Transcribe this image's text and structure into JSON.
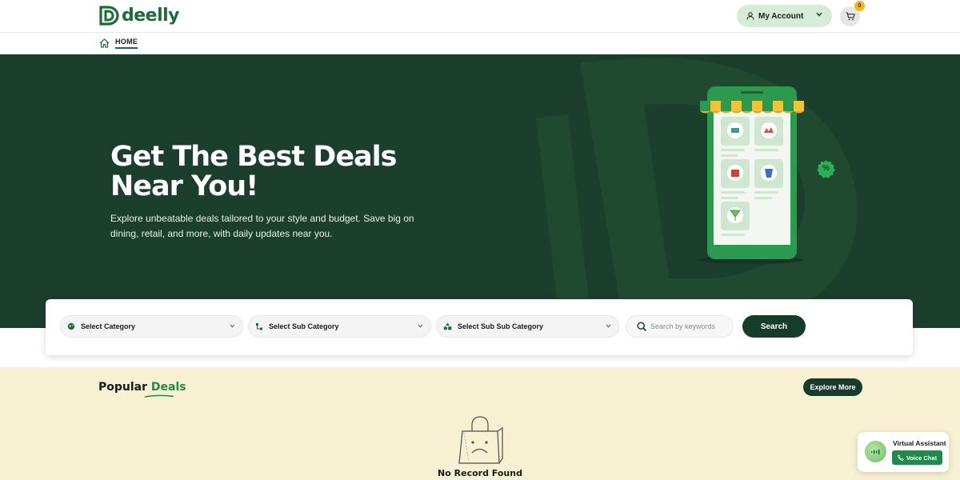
{
  "brand": {
    "name": "deelly",
    "logo_icon": "deelly-logo-icon"
  },
  "header": {
    "account_label": "My Account",
    "account_icon": "user-icon",
    "cart_icon": "cart-icon",
    "cart_count": "0"
  },
  "breadcrumb": {
    "home_label": "HOME",
    "home_icon": "home-icon"
  },
  "hero": {
    "title": "Get The Best Deals Near You!",
    "subtitle": "Explore unbeatable deals tailored to your style and budget. Save big on dining, retail, and more, with daily updates near you.",
    "badge_symbol": "%"
  },
  "search": {
    "category_label": "Select Category",
    "sub_category_label": "Select Sub Category",
    "sub_sub_category_label": "Select Sub Sub Category",
    "keyword_placeholder": "Search by keywords",
    "keyword_value": "",
    "button_label": "Search"
  },
  "deals": {
    "title_prefix": "Popular",
    "title_highlight": "Deals",
    "explore_label": "Explore More",
    "empty_message": "No Record Found"
  },
  "assistant": {
    "title": "Virtual Assistant",
    "button_label": "Voice Chat"
  },
  "colors": {
    "brand_green": "#1f6b3a",
    "hero_bg": "#1b3e2d",
    "button_dark": "#163d2b",
    "accent_green": "#1f8a4c",
    "deals_bg": "#f8f0d3",
    "account_bg": "#d5ecd9",
    "badge_yellow": "#f3b51b"
  }
}
